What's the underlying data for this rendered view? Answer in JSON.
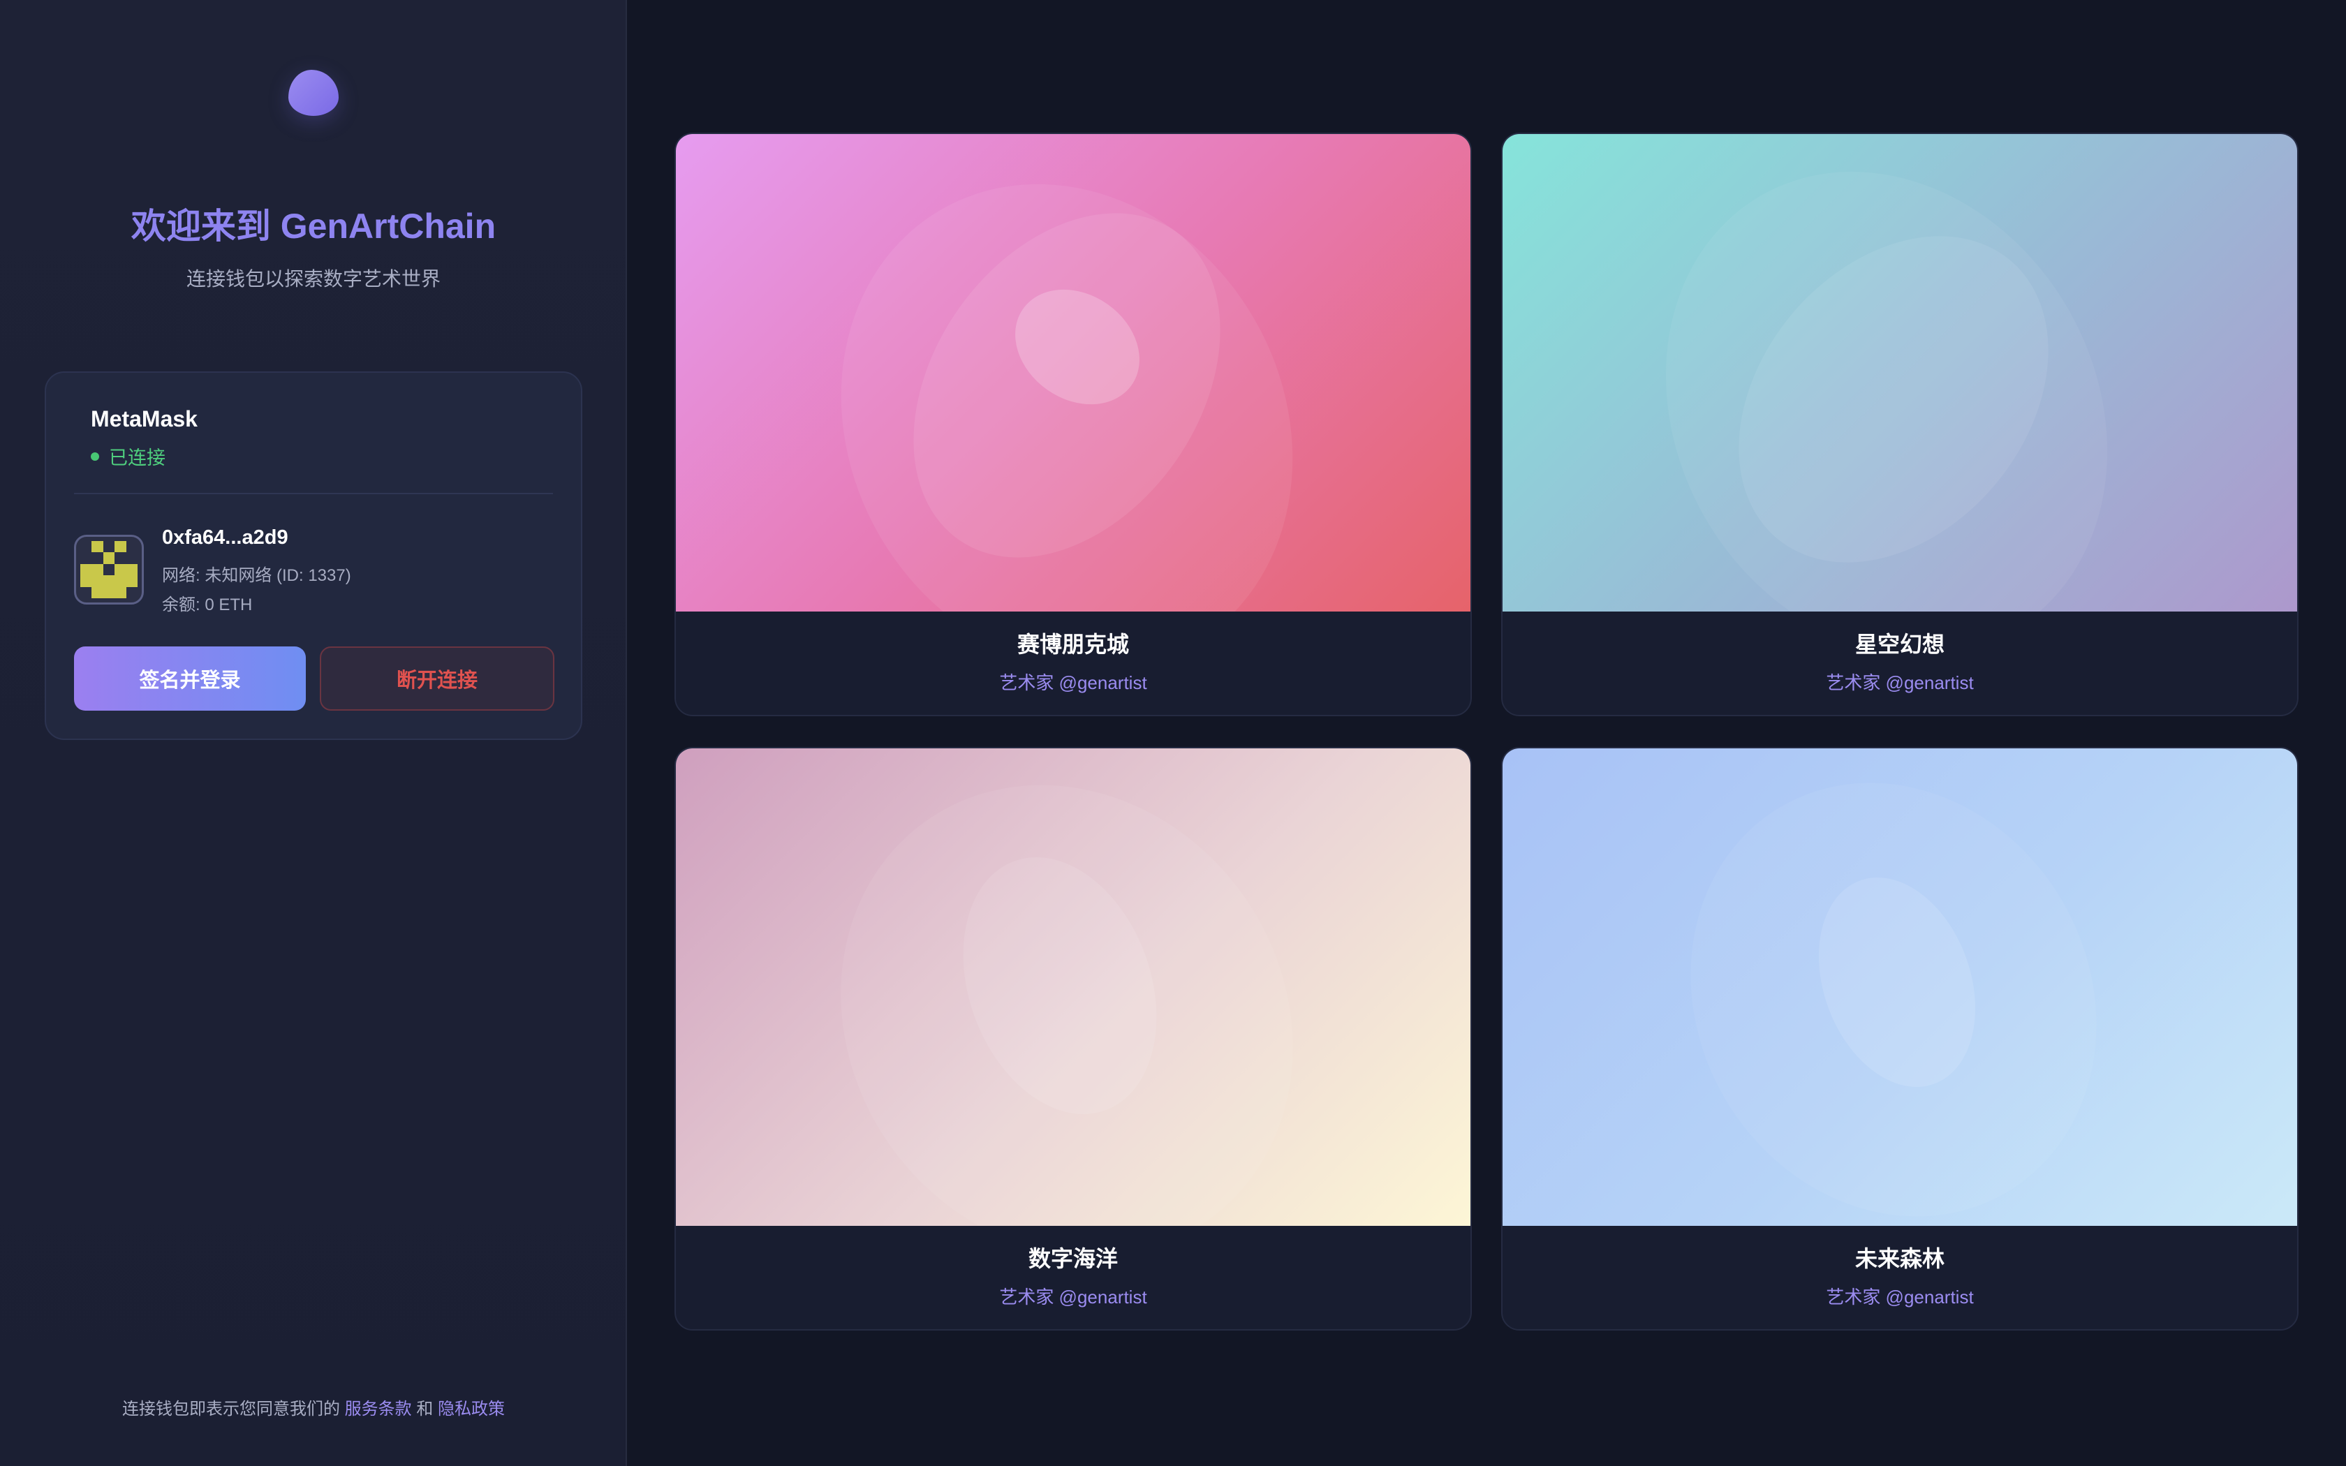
{
  "sidebar": {
    "welcome_title": "欢迎来到 GenArtChain",
    "welcome_subtitle": "连接钱包以探索数字艺术世界",
    "wallet": {
      "name": "MetaMask",
      "status": "已连接",
      "address": "0xfa64...a2d9",
      "network": "网络: 未知网络 (ID: 1337)",
      "balance": "余额: 0 ETH",
      "sign_button": "签名并登录",
      "disconnect_button": "断开连接"
    },
    "terms": {
      "prefix": "连接钱包即表示您同意我们的",
      "terms_link": "服务条款",
      "and": "和",
      "privacy_link": "隐私政策"
    }
  },
  "gallery": {
    "cards": [
      {
        "title": "赛博朋克城",
        "artist": "艺术家 @genartist"
      },
      {
        "title": "星空幻想",
        "artist": "艺术家 @genartist"
      },
      {
        "title": "数字海洋",
        "artist": "艺术家 @genartist"
      },
      {
        "title": "未来森林",
        "artist": "艺术家 @genartist"
      }
    ]
  },
  "colors": {
    "accent": "#8e84f0",
    "connected": "#4fcf7e",
    "danger": "#e0524f",
    "background": "#121625"
  }
}
